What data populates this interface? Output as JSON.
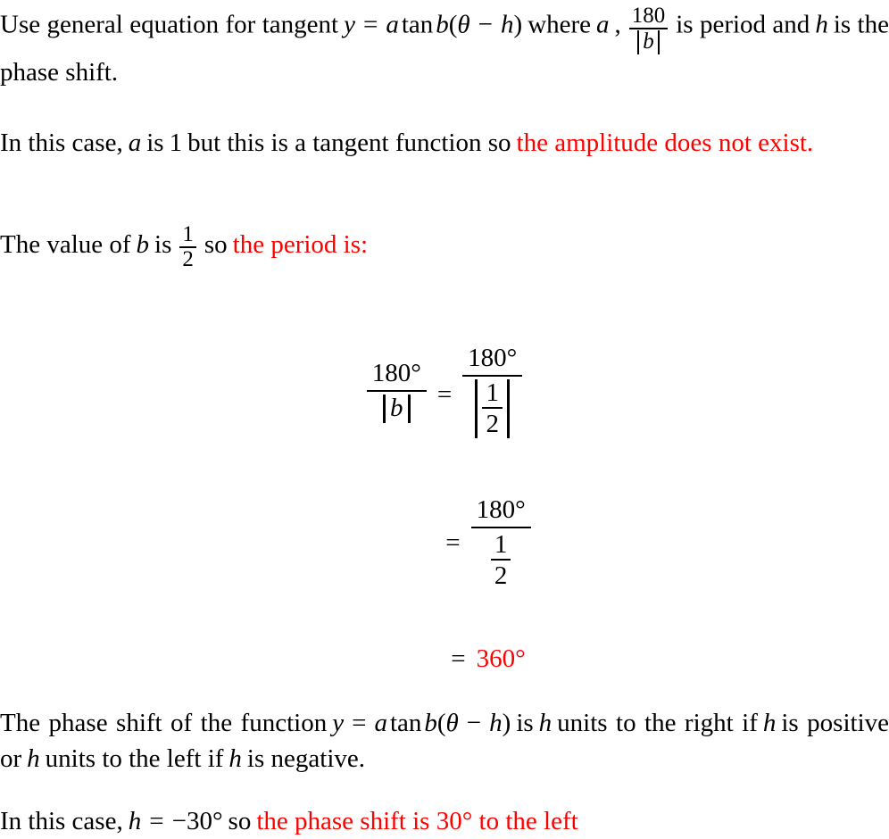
{
  "document": {
    "type": "math-solution",
    "topic": "Tangent function: amplitude, period, and phase shift",
    "text_color": "#000000",
    "highlight_color": "#ff0000",
    "background_color": "#ffffff"
  },
  "paragraph1": {
    "t1": "Use general equation for tangent",
    "equation": {
      "y": "y",
      "eq": "=",
      "a": "a",
      "tan": "tan",
      "b": "b",
      "open": "(",
      "theta": "θ",
      "minus": "−",
      "h": "h",
      "close": ")"
    },
    "t2": "where",
    "var_a": "a",
    "comma": ",",
    "period_fraction": {
      "numerator": "180",
      "denominator_var": "b"
    },
    "t3": "is period and",
    "var_h": "h",
    "t4": "is the phase shift."
  },
  "paragraph2": {
    "t1": "In this case,",
    "var_a": "a",
    "t2": "is",
    "value_a": "1",
    "t3": "but this is a tangent function so",
    "highlight": "the amplitude does not exist."
  },
  "paragraph3": {
    "t1": "The value of",
    "var_b": "b",
    "t2": "is",
    "value_b": {
      "numerator": "1",
      "denominator": "2"
    },
    "t3": "so",
    "highlight": "the period is:"
  },
  "equations": {
    "line1": {
      "left": {
        "numerator": "180°",
        "denominator_var": "b"
      },
      "operator": "=",
      "right": {
        "numerator": "180°",
        "denominator_fraction": {
          "numerator": "1",
          "denominator": "2"
        }
      }
    },
    "line2": {
      "operator": "=",
      "fraction": {
        "numerator": "180°",
        "denominator_fraction": {
          "numerator": "1",
          "denominator": "2"
        }
      }
    },
    "line3": {
      "operator": "=",
      "result": "360°"
    }
  },
  "paragraph4": {
    "t1": "The phase shift of the function",
    "equation": {
      "y": "y",
      "eq": "=",
      "a": "a",
      "tan": "tan",
      "b": "b",
      "open": "(",
      "theta": "θ",
      "minus": "−",
      "h": "h",
      "close": ")"
    },
    "t2": "is",
    "var_h1": "h",
    "t3": "units to the right if",
    "var_h2": "h",
    "t4": "is positive or",
    "var_h3": "h",
    "t5": "units to the left if",
    "var_h4": "h",
    "t6": "is negative."
  },
  "paragraph5": {
    "t1": "In this case,",
    "equation": {
      "h": "h",
      "eq": "=",
      "minus": "−",
      "value": "30°"
    },
    "t2": "so",
    "highlight": "the phase shift is 30° to the left"
  }
}
